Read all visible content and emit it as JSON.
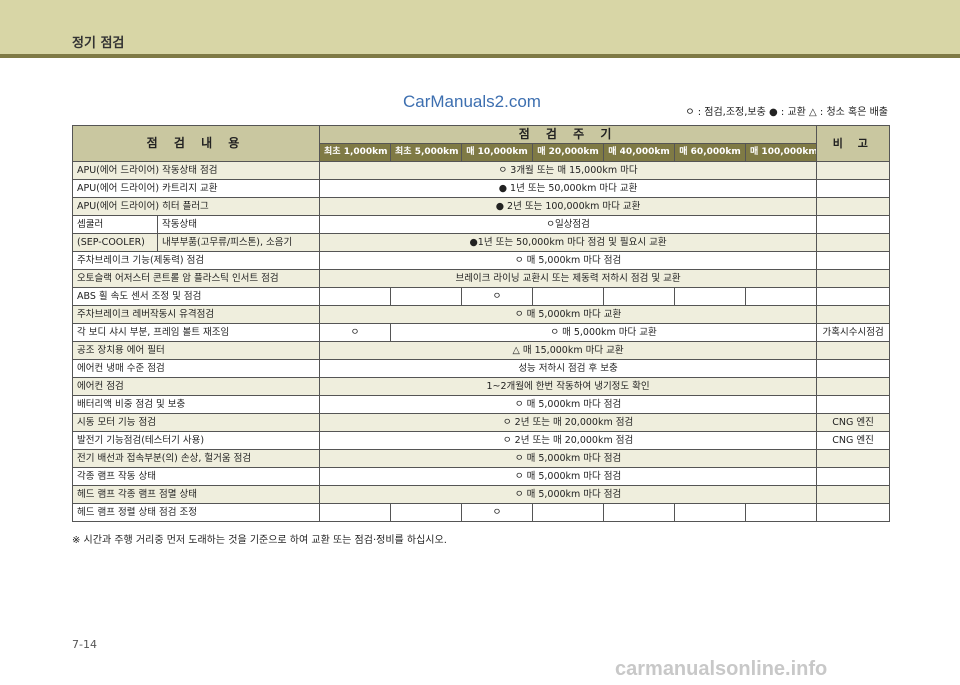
{
  "header": {
    "title": "정기 점검"
  },
  "watermark_top": "CarManuals2.com",
  "legend": "ㅇ : 점검,조정,보충  ● : 교환  △ : 청소 혹은 배출",
  "table": {
    "col_item": "점 검 내 용",
    "col_period": "점 검 주 기",
    "col_note": "비 고",
    "periods": [
      "최초 1,000km",
      "최초 5,000km",
      "매 10,000km",
      "매 20,000km",
      "매 40,000km",
      "매 60,000km",
      "매 100,000km"
    ],
    "rows": [
      {
        "item": "APU(에어 드라이어) 작동상태 점검",
        "span": "ㅇ 3개월 또는 매 15,000km 마다",
        "note": ""
      },
      {
        "item": "APU(에어 드라이어) 카트리지 교환",
        "span": "● 1년 또는 50,000km 마다 교환",
        "note": ""
      },
      {
        "item": "APU(에어 드라이어) 히터 플러그",
        "span": "● 2년 또는 100,000km 마다 교환",
        "note": ""
      },
      {
        "item": "작동상태",
        "group": "셉쿨러",
        "span": "ㅇ일상점검",
        "note": ""
      },
      {
        "item": "내부부품(고무류/피스톤), 소음기",
        "group": "(SEP-COOLER)",
        "span": "●1년 또는 50,000km 마다 점검 및 필요시 교환",
        "note": ""
      },
      {
        "item": "주차브레이크 기능(제동력) 점검",
        "span": "ㅇ 매 5,000km 마다 점검",
        "note": ""
      },
      {
        "item": "오토슬랙 어저스터 콘트롤 암 플라스틱 인서트 점검",
        "span": "브레이크 라이닝 교환시 또는 제동력 저하시 점검 및 교환",
        "note": ""
      },
      {
        "item": "ABS 휠 속도 센서 조정 및 점검",
        "cells": [
          "",
          "",
          "ㅇ",
          "",
          "",
          "",
          ""
        ],
        "note": ""
      },
      {
        "item": "주차브레이크 레버작동시 유격점검",
        "span": "ㅇ 매 5,000km 마다 교환",
        "note": ""
      },
      {
        "item": "각 보디 샤시 부분, 프레임 볼트 재조임",
        "first": "ㅇ",
        "span": "ㅇ 매 5,000km 마다 교환",
        "note": "가혹시수시점검"
      },
      {
        "item": "공조 장치용 에어 필터",
        "span": "△ 매 15,000km 마다 교환",
        "note": ""
      },
      {
        "item": "에어컨 냉매 수준 점검",
        "span": "성능 저하시 점검 후 보충",
        "note": ""
      },
      {
        "item": "에어컨 점검",
        "span": "1~2개월에 한번 작동하여 냉기정도 확인",
        "note": ""
      },
      {
        "item": "배터리액 비중 점검 및 보충",
        "span": "ㅇ 매 5,000km 마다 점검",
        "note": ""
      },
      {
        "item": "시동 모터 기능 점검",
        "span": "ㅇ 2년 또는 매 20,000km 점검",
        "note": "CNG 엔진"
      },
      {
        "item": "발전기 기능점검(테스터기 사용)",
        "span": "ㅇ 2년 또는 매 20,000km 점검",
        "note": "CNG 엔진"
      },
      {
        "item": "전기 배선과 접속부분(의) 손상, 헐거움 점검",
        "span": "ㅇ 매 5,000km 마다 점검",
        "note": ""
      },
      {
        "item": "각종 램프 작동 상태",
        "span": "ㅇ 매 5,000km 마다 점검",
        "note": ""
      },
      {
        "item": "헤드 램프 각종 램프 점멸 상태",
        "span": "ㅇ 매 5,000km 마다 점검",
        "note": ""
      },
      {
        "item": "헤드 램프 정렬 상태 점검 조정",
        "cells": [
          "",
          "",
          "ㅇ",
          "",
          "",
          "",
          ""
        ],
        "note": ""
      }
    ]
  },
  "footnote": "※ 시간과 주행 거리중 먼저 도래하는 것을 기준으로 하여 교환 또는 점검·정비를 하십시오.",
  "page_number": "7-14",
  "watermark_bottom": "carmanualsonline.info"
}
